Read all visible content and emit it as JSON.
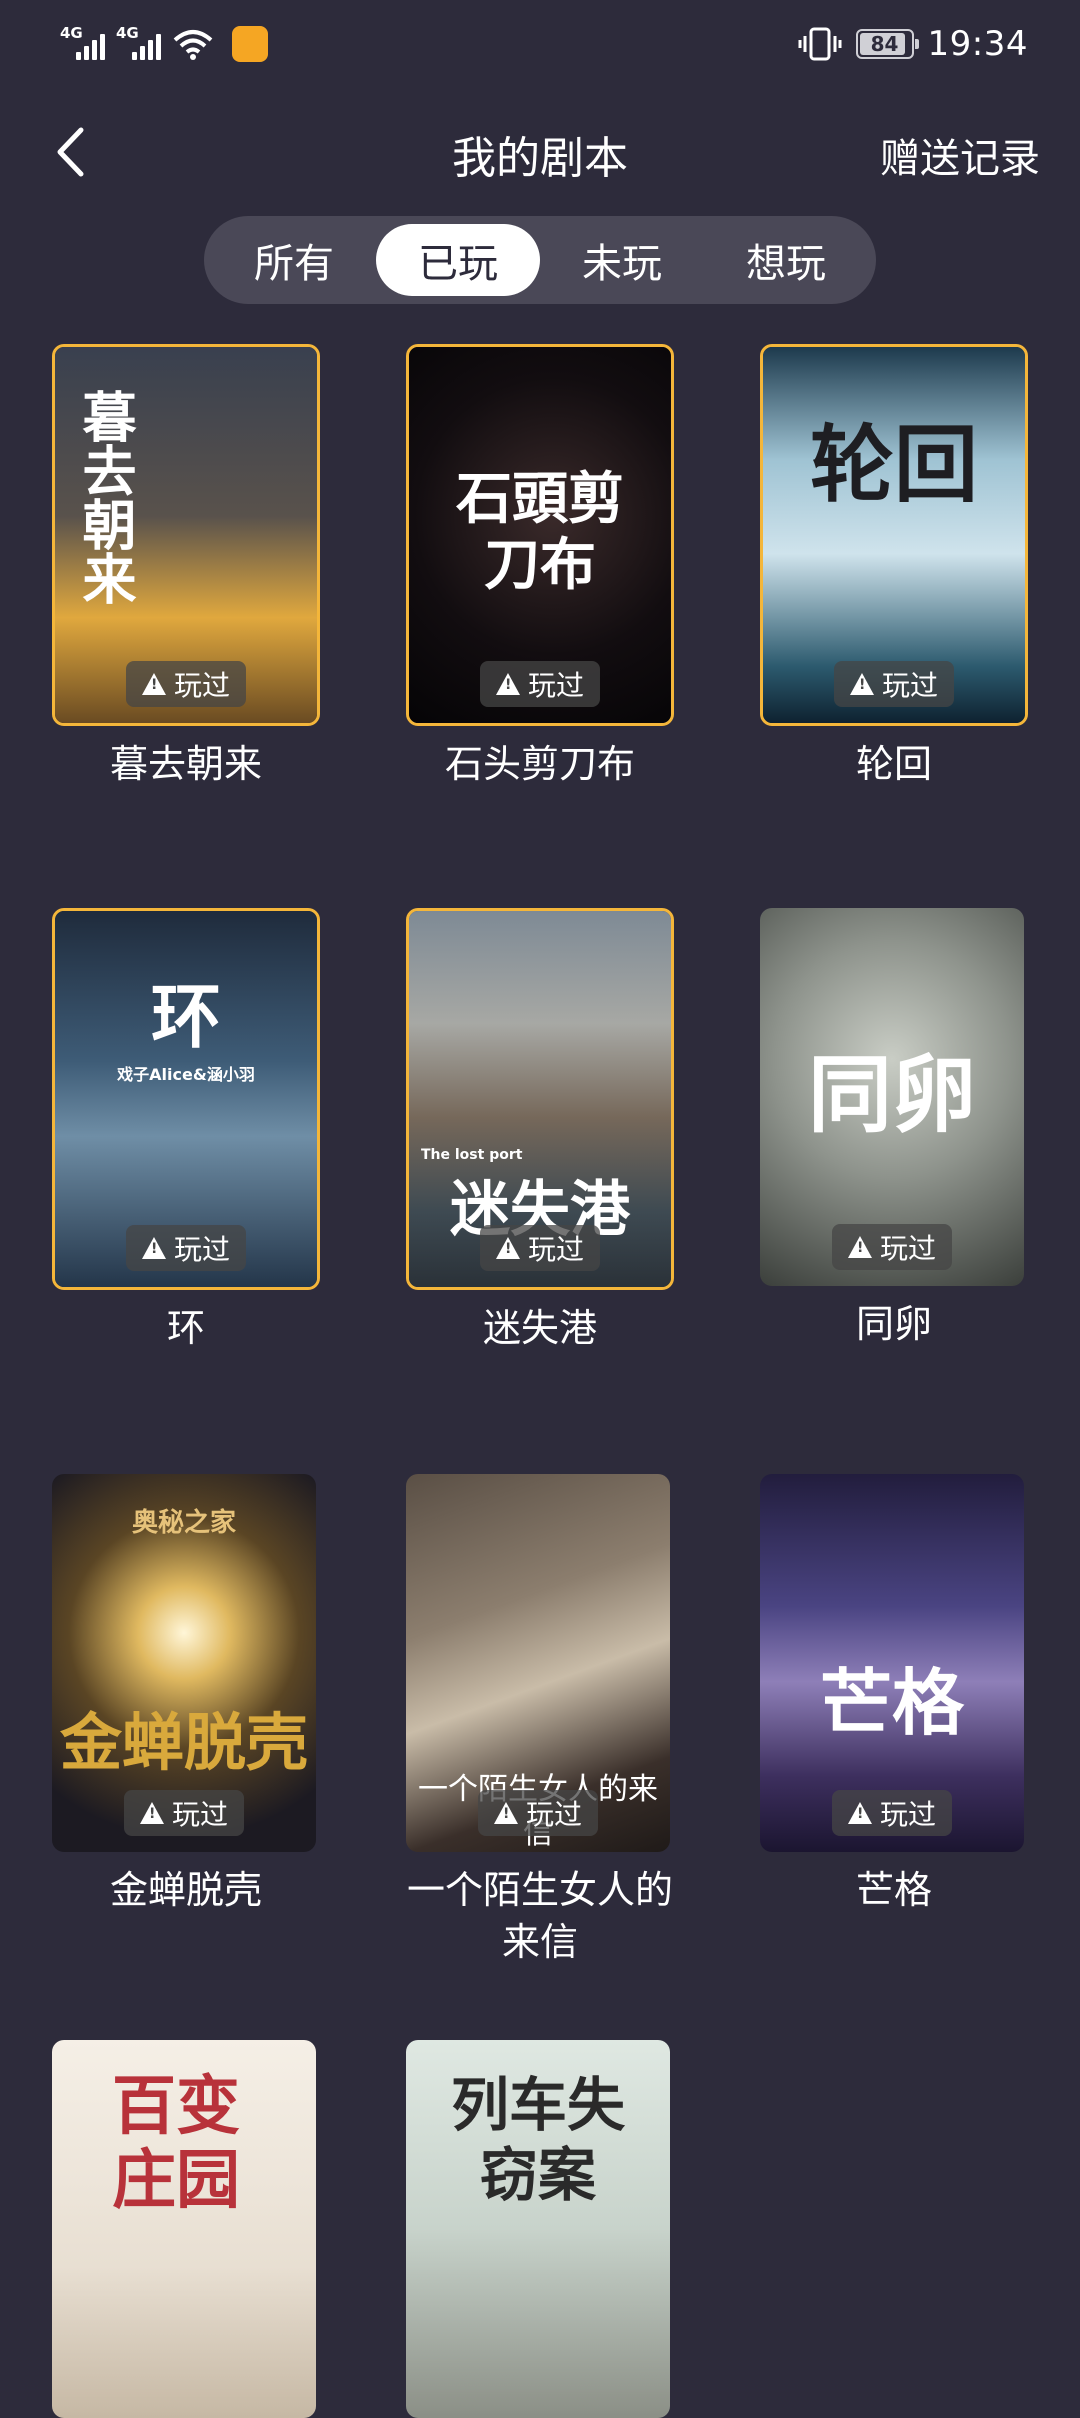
{
  "status_bar": {
    "signal1_tag": "4G",
    "signal2_tag": "4G",
    "battery": "84",
    "time": "19:34"
  },
  "header": {
    "back_icon": "chevron-left-icon",
    "title": "我的剧本",
    "right_action": "赠送记录"
  },
  "tabs": [
    {
      "label": "所有",
      "active": false
    },
    {
      "label": "已玩",
      "active": true
    },
    {
      "label": "未玩",
      "active": false
    },
    {
      "label": "想玩",
      "active": false
    }
  ],
  "played_badge": "玩过",
  "scripts": [
    {
      "name": "暮去朝来",
      "cover_text": "暮去朝来",
      "played": true,
      "selected": true
    },
    {
      "name": "石头剪刀布",
      "cover_text": "石頭剪刀布",
      "played": true,
      "selected": true
    },
    {
      "name": "轮回",
      "cover_text": "轮回",
      "played": true,
      "selected": true
    },
    {
      "name": "环",
      "cover_text": "环",
      "cover_subtext": "戏子Alice&涵小羽",
      "played": true,
      "selected": true
    },
    {
      "name": "迷失港",
      "cover_text": "迷失港",
      "cover_subtext": "The lost port",
      "played": true,
      "selected": true
    },
    {
      "name": "同卵",
      "cover_text": "同卵",
      "played": true,
      "selected": false
    },
    {
      "name": "金蝉脱壳",
      "cover_text": "金蝉脱壳",
      "cover_subtext": "奥秘之家",
      "played": true,
      "selected": false
    },
    {
      "name": "一个陌生女人的来信",
      "cover_text": "一个陌生女人的来信",
      "played": true,
      "selected": false
    },
    {
      "name": "芒格",
      "cover_text": "芒格",
      "played": true,
      "selected": false
    },
    {
      "name": "",
      "cover_text": "百变庄园",
      "played": false,
      "selected": false
    },
    {
      "name": "",
      "cover_text": "列车失窃案",
      "played": false,
      "selected": false
    }
  ],
  "colors": {
    "background": "#2d2b3b",
    "tab_bar": "#4a4857",
    "selected_border": "#f4b63a"
  }
}
